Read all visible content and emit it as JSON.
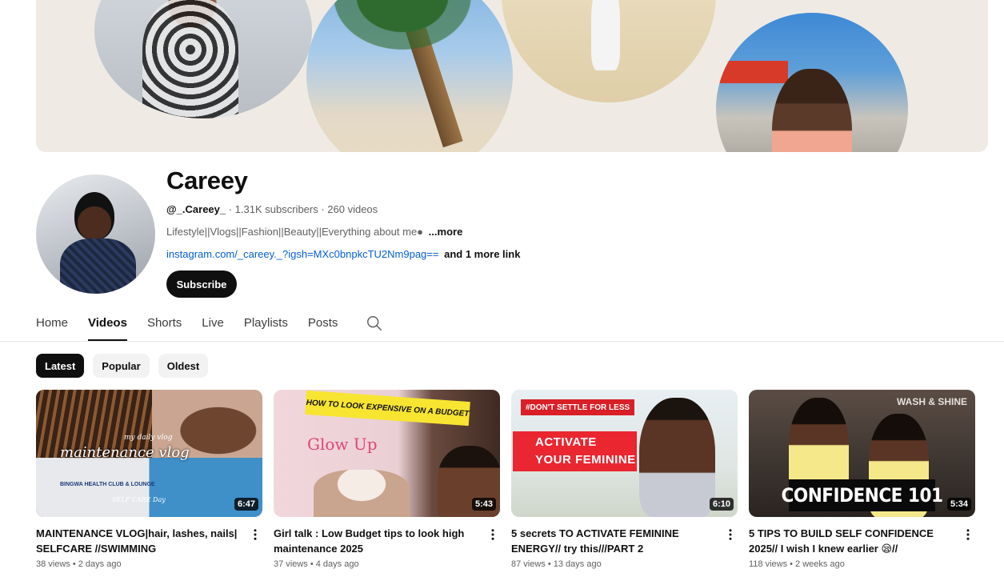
{
  "channel": {
    "name": "Careey",
    "handle": "@_.Careey_",
    "stats": " · 1.31K subscribers · 260 videos",
    "description": "Lifestyle||Vlogs||Fashion||Beauty||Everything about me●",
    "description_more": "...more",
    "link": "instagram.com/_careey._?igsh=MXc0bnpkcTU2Nm9pag==",
    "more_links": "and 1 more link",
    "subscribe_label": "Subscribe"
  },
  "tabs": [
    {
      "label": "Home",
      "active": false
    },
    {
      "label": "Videos",
      "active": true
    },
    {
      "label": "Shorts",
      "active": false
    },
    {
      "label": "Live",
      "active": false
    },
    {
      "label": "Playlists",
      "active": false
    },
    {
      "label": "Posts",
      "active": false
    }
  ],
  "tabs_search_icon": "search-icon",
  "chips": [
    {
      "label": "Latest",
      "active": true
    },
    {
      "label": "Popular",
      "active": false
    },
    {
      "label": "Oldest",
      "active": false
    }
  ],
  "videos": [
    {
      "title": "MAINTENANCE VLOG|hair, lashes, nails| SELFCARE //SWIMMING",
      "duration": "6:47",
      "meta": "38 views • 2 days ago",
      "thumb_text": "maintenance vlog",
      "thumb_small": "my daily vlog",
      "thumb_sign": "BINGWA HEALTH CLUB & LOUNGE",
      "thumb_day": "SELF CARE Day"
    },
    {
      "title": "Girl talk : Low Budget tips to look high maintenance 2025",
      "duration": "5:43",
      "meta": "37 views • 4 days ago",
      "thumb_banner": "HOW TO LOOK EXPENSIVE ON A BUDGET",
      "thumb_glow": "Glow Up"
    },
    {
      "title": "5 secrets TO ACTIVATE FEMININE ENERGY// try this///PART 2",
      "duration": "6:10",
      "meta": "87 views • 13 days ago",
      "thumb_top": "#DON'T SETTLE FOR LESS",
      "thumb_line1": "ACTIVATE",
      "thumb_line2": "YOUR FEMININE"
    },
    {
      "title": "5 TIPS TO BUILD SELF CONFIDENCE 2025// I wish I knew earlier 😪//",
      "duration": "5:34",
      "meta": "118 views • 2 weeks ago",
      "thumb_wash": "WASH & SHINE",
      "thumb_conf": "CONFIDENCE 101"
    }
  ],
  "kebab_icon": "more-vert-icon"
}
